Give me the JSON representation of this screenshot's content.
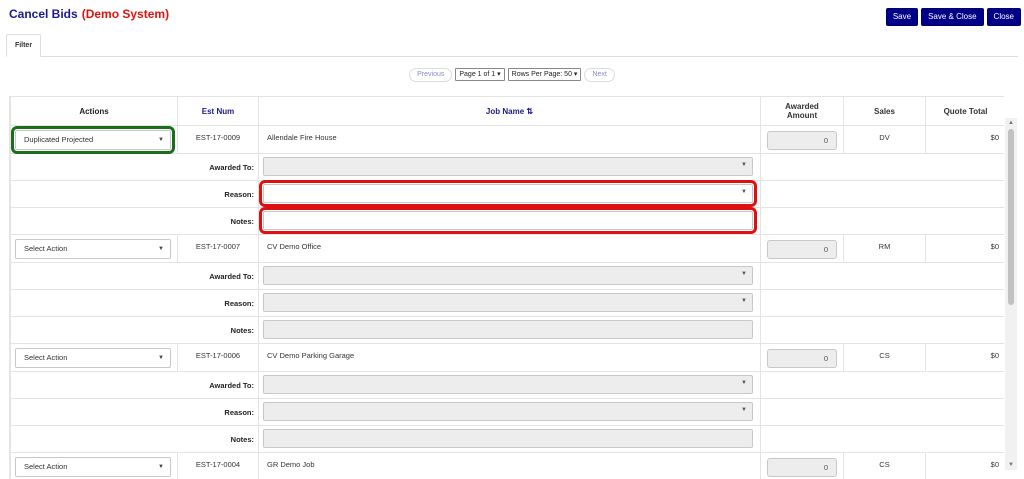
{
  "header": {
    "title": "Cancel Bids",
    "system_tag": "(Demo System)",
    "buttons": {
      "save": "Save",
      "save_close": "Save & Close",
      "close": "Close"
    }
  },
  "tabs": [
    {
      "label": "Filter"
    }
  ],
  "pager": {
    "previous": "Previous",
    "page_select": "Page 1 of 1",
    "rows_select": "Rows Per Page: 50",
    "next": "Next"
  },
  "columns": {
    "actions": "Actions",
    "est_num": "Est Num",
    "job_name": "Job Name",
    "awarded_amount_line1": "Awarded",
    "awarded_amount_line2": "Amount",
    "sales": "Sales",
    "quote_total": "Quote Total"
  },
  "sub_labels": {
    "awarded_to": "Awarded To:",
    "reason": "Reason:",
    "notes": "Notes:"
  },
  "rows": [
    {
      "action": "Duplicated Projected",
      "est": "EST-17-0009",
      "job": "Allendale Fire House",
      "awarded_amount": "0",
      "sales": "DV",
      "quote_total": "$0"
    },
    {
      "action": "Select Action",
      "est": "EST-17-0007",
      "job": "CV Demo Office",
      "awarded_amount": "0",
      "sales": "RM",
      "quote_total": "$0"
    },
    {
      "action": "Select Action",
      "est": "EST-17-0006",
      "job": "CV Demo Parking Garage",
      "awarded_amount": "0",
      "sales": "CS",
      "quote_total": "$0"
    },
    {
      "action": "Select Action",
      "est": "EST-17-0004",
      "job": "GR Demo Job",
      "awarded_amount": "0",
      "sales": "CS",
      "quote_total": "$0"
    }
  ],
  "colors": {
    "title": "#1a1a8c",
    "system_tag": "#e0140e",
    "button": "#000088",
    "highlight_action": "#1b6e1b",
    "highlight_required": "#dd1111"
  },
  "icons": {
    "dropdown": "chevron-down-icon",
    "sort": "sort-icon",
    "scroll_up": "scroll-up-icon",
    "scroll_down": "scroll-down-icon"
  }
}
